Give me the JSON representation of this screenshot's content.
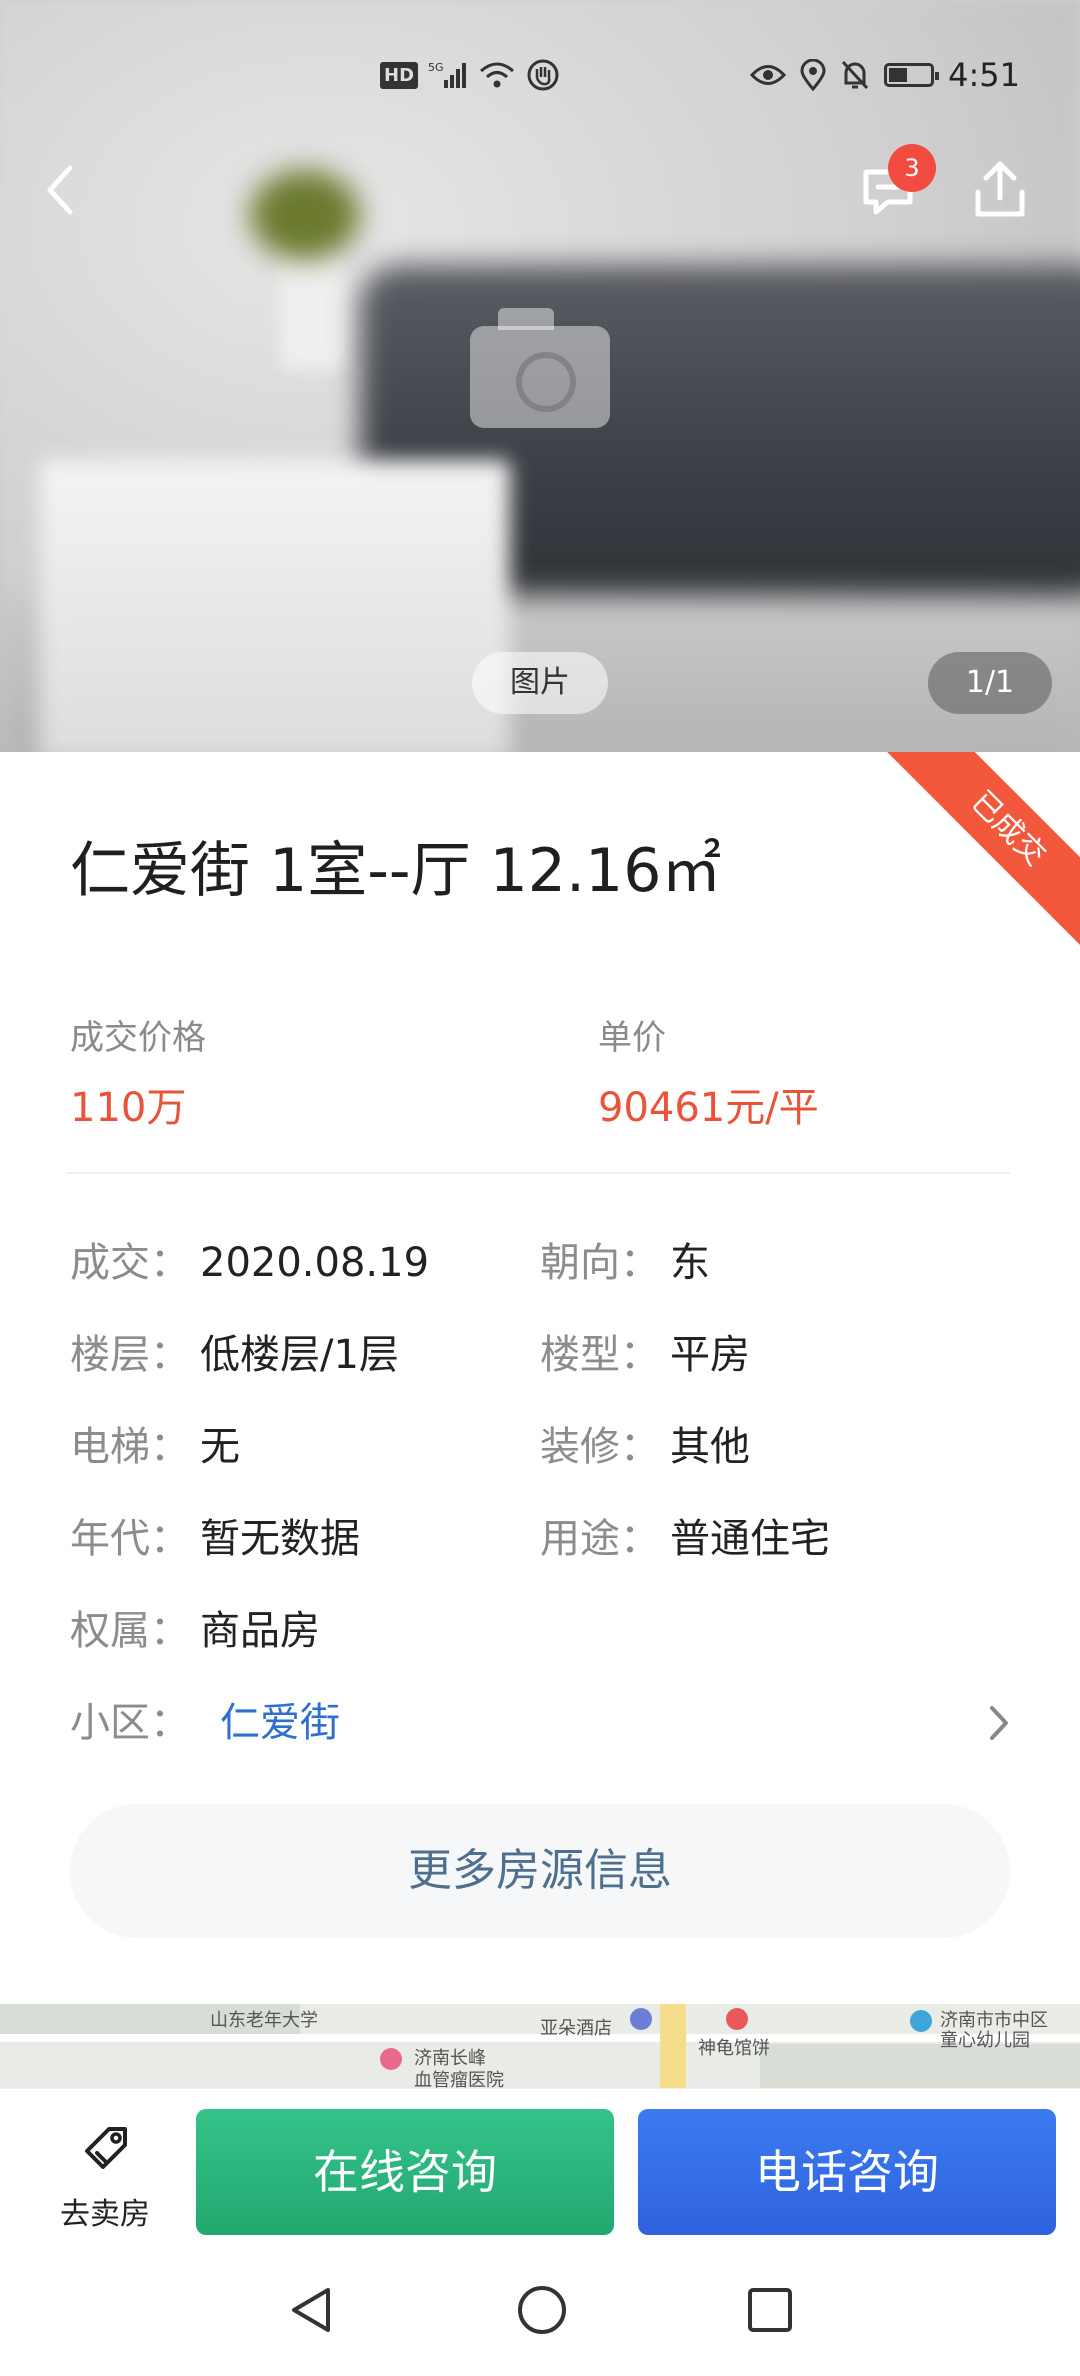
{
  "status_bar": {
    "time": "4:51",
    "hd": "HD",
    "network": "5G",
    "icons": [
      "signal-icon",
      "wifi-icon",
      "hand-icon",
      "eye-icon",
      "location-icon",
      "mute-icon",
      "battery-icon"
    ]
  },
  "header": {
    "back_icon": "chevron-left-icon",
    "message_icon": "message-icon",
    "message_badge": "3",
    "share_icon": "share-icon"
  },
  "gallery": {
    "photo_label": "图片",
    "counter": "1/1"
  },
  "listing": {
    "status_ribbon": "已成交",
    "title": "仁爱街 1室--厅 12.16㎡",
    "deal_price_label": "成交价格",
    "deal_price": "110万",
    "unit_price_label": "单价",
    "unit_price": "90461元/平",
    "details": {
      "deal_date_k": "成交：",
      "deal_date_v": "2020.08.19",
      "orientation_k": "朝向：",
      "orientation_v": "东",
      "floor_k": "楼层：",
      "floor_v": "低楼层/1层",
      "building_type_k": "楼型：",
      "building_type_v": "平房",
      "elevator_k": "电梯：",
      "elevator_v": "无",
      "decoration_k": "装修：",
      "decoration_v": "其他",
      "year_k": "年代：",
      "year_v": "暂无数据",
      "usage_k": "用途：",
      "usage_v": "普通住宅",
      "ownership_k": "权属：",
      "ownership_v": "商品房",
      "community_k": "小区：",
      "community_v": "仁爱街"
    },
    "more_info_button": "更多房源信息"
  },
  "map": {
    "labels": [
      "山东老年大学",
      "亚朵酒店",
      "济南长峰",
      "血管瘤医院",
      "神龟馆饼",
      "济南市市中区",
      "童心幼儿园"
    ]
  },
  "action_bar": {
    "sell_label": "去卖房",
    "online_consult": "在线咨询",
    "phone_consult": "电话咨询"
  },
  "colors": {
    "price_red": "#e9533a",
    "ribbon_red": "#f2593c",
    "link_blue": "#2f6fd0",
    "online_green": "#22a86f",
    "phone_blue": "#2f62de"
  }
}
